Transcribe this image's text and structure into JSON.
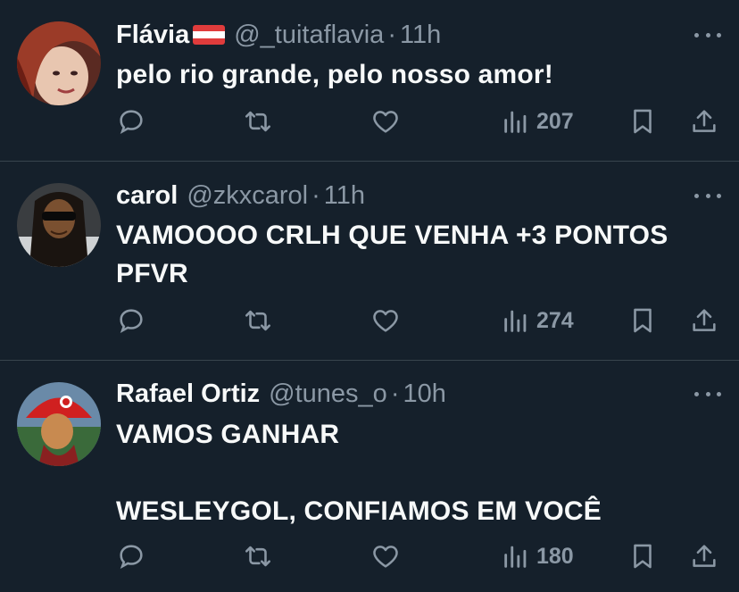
{
  "tweets": [
    {
      "name": "Flávia",
      "handle": "@_tuitaflavia",
      "dot": "·",
      "time": "11h",
      "lines": [
        "pelo rio grande, pelo nosso amor!"
      ],
      "views": "207",
      "avatar_color": "#8a3a2a"
    },
    {
      "name": "carol",
      "handle": "@zkxcarol",
      "dot": "·",
      "time": "11h",
      "lines": [
        "VAMOOOO CRLH QUE VENHA +3 PONTOS",
        "PFVR"
      ],
      "views": "274",
      "avatar_color": "#2a2c2e"
    },
    {
      "name": "Rafael Ortiz",
      "handle": "@tunes_o",
      "dot": "·",
      "time": "10h",
      "lines": [
        "VAMOS GANHAR",
        "",
        "WESLEYGOL, CONFIAMOS EM VOCÊ"
      ],
      "views": "180",
      "avatar_color": "#4a6a8a"
    }
  ],
  "icons": {
    "reply": "reply-icon",
    "retweet": "retweet-icon",
    "like": "heart-icon",
    "views": "views-chart-icon",
    "bookmark": "bookmark-icon",
    "share": "share-icon",
    "more": "more-options-icon"
  },
  "colors": {
    "background": "#15202b",
    "text_primary": "#f7f9f9",
    "text_secondary": "#8b98a5",
    "divider": "#38444d"
  }
}
